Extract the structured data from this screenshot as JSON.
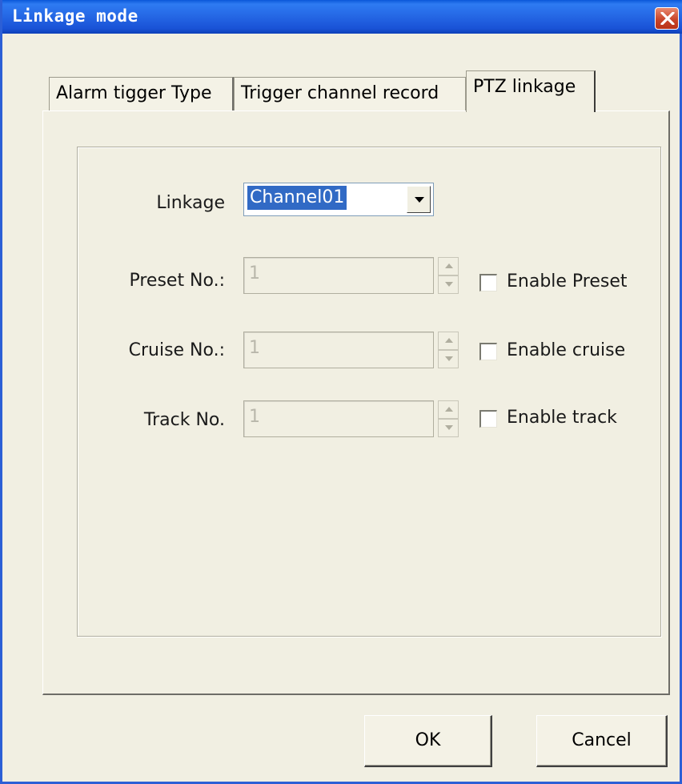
{
  "window": {
    "title": "Linkage mode"
  },
  "tabs": [
    {
      "label": "Alarm tigger Type",
      "active": false
    },
    {
      "label": "Trigger channel record",
      "active": false
    },
    {
      "label": "PTZ linkage",
      "active": true
    }
  ],
  "form": {
    "linkage_label": "Linkage",
    "linkage_value": "Channel01",
    "preset_label": "Preset No.:",
    "preset_value": "1",
    "preset_check_label": "Enable Preset",
    "preset_checked": false,
    "cruise_label": "Cruise No.:",
    "cruise_value": "1",
    "cruise_check_label": "Enable cruise",
    "cruise_checked": false,
    "track_label": "Track No.",
    "track_value": "1",
    "track_check_label": "Enable track",
    "track_checked": false
  },
  "buttons": {
    "ok": "OK",
    "cancel": "Cancel"
  },
  "icons": {
    "close": "close-icon",
    "dropdown": "chevron-down-icon",
    "spin_up": "spin-up-icon",
    "spin_down": "spin-down-icon"
  },
  "colors": {
    "titlebar": "#2669e6",
    "close_button": "#c9452a",
    "selection": "#316ac5",
    "dialog_bg": "#f1efe2"
  }
}
